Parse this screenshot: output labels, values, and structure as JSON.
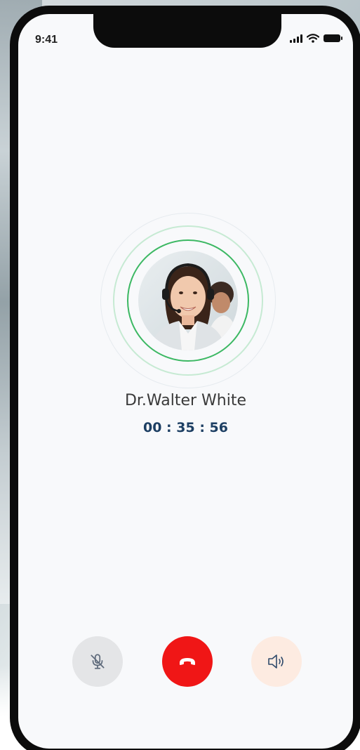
{
  "status_bar": {
    "time": "9:41",
    "icons": [
      "cellular-signal-icon",
      "wifi-icon",
      "battery-icon"
    ]
  },
  "call": {
    "caller_name": "Dr.Walter White",
    "duration": "00 : 35 : 56",
    "avatar": "caller-avatar-photo"
  },
  "controls": [
    {
      "icon": "microphone-muted-icon",
      "background": "#e4e5e7"
    },
    {
      "icon": "end-call-icon",
      "background": "#f01616"
    },
    {
      "icon": "speaker-icon",
      "background": "#fdebe1"
    }
  ],
  "colors": {
    "ring_active": "#3cb863",
    "ring_soft": "#c6ead3",
    "end_call": "#f01616",
    "timer_text": "#1d3f63",
    "name_text": "#3a3a3a"
  }
}
